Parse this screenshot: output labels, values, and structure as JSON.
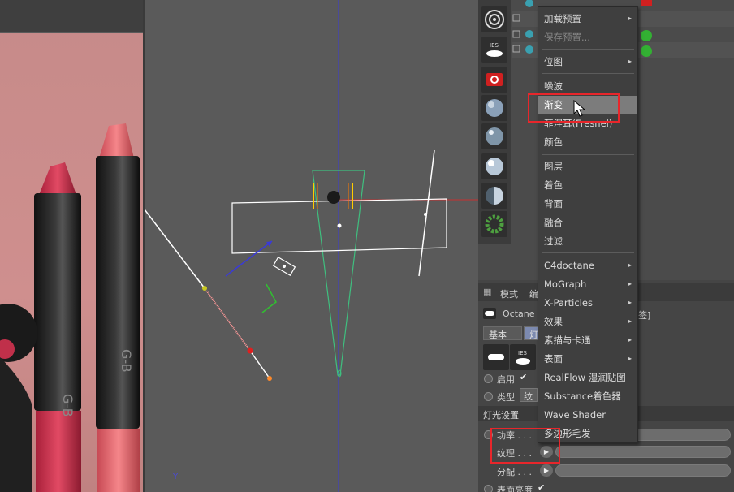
{
  "menu": {
    "items": [
      {
        "label": "加载预置",
        "has_sub": true,
        "disabled": false
      },
      {
        "label": "保存预置...",
        "has_sub": false,
        "disabled": true
      },
      {
        "label": "位图",
        "has_sub": true,
        "disabled": false
      },
      {
        "label": "噪波",
        "has_sub": false,
        "disabled": false
      },
      {
        "label": "渐变",
        "has_sub": false,
        "disabled": false,
        "highlighted": true
      },
      {
        "label": "菲涅耳(Fresnel)",
        "has_sub": false,
        "disabled": false
      },
      {
        "label": "颜色",
        "has_sub": false,
        "disabled": false
      },
      {
        "label": "图层",
        "has_sub": false,
        "disabled": false
      },
      {
        "label": "着色",
        "has_sub": false,
        "disabled": false
      },
      {
        "label": "背面",
        "has_sub": false,
        "disabled": false
      },
      {
        "label": "融合",
        "has_sub": false,
        "disabled": false
      },
      {
        "label": "过滤",
        "has_sub": false,
        "disabled": false
      },
      {
        "label": "C4doctane",
        "has_sub": true,
        "disabled": false
      },
      {
        "label": "MoGraph",
        "has_sub": true,
        "disabled": false
      },
      {
        "label": "X-Particles",
        "has_sub": true,
        "disabled": false
      },
      {
        "label": "效果",
        "has_sub": true,
        "disabled": false
      },
      {
        "label": "素描与卡通",
        "has_sub": true,
        "disabled": false
      },
      {
        "label": "表面",
        "has_sub": true,
        "disabled": false
      },
      {
        "label": "RealFlow 湿润贴图",
        "has_sub": false,
        "disabled": false
      },
      {
        "label": "Substance着色器",
        "has_sub": false,
        "disabled": false
      },
      {
        "label": "Wave Shader",
        "has_sub": false,
        "disabled": false
      },
      {
        "label": "多边形毛发",
        "has_sub": false,
        "disabled": false
      }
    ],
    "submenu_arrow": "▸"
  },
  "attributes": {
    "header_mode": "模式",
    "header_edit_partial": "编",
    "object_name_partial": "Octane",
    "object_suffix_partial": "签]",
    "tab_basic": "基本",
    "tab_light_partial": "灯",
    "enable_label": "启用",
    "enable_check": "✔",
    "type_label": "类型",
    "type_value_partial": "纹",
    "section_title": "灯光设置",
    "power_label": "功率 . . .",
    "texture_label": "纹理 . . .",
    "distribution_label": "分配 . . .",
    "surface_brightness_label": "表面亮度",
    "surface_brightness_check": "✔"
  },
  "tools": {
    "ies_label": "IES"
  },
  "viewport": {
    "axis_label": "Y",
    "colors": {
      "selection_outline": "#ffffff",
      "light_cone": "#3fbf7f",
      "axis_blue": "#3a3ad8",
      "axis_red": "#c83030",
      "target_line": "#ff9999"
    }
  },
  "colors": {
    "highlight_box": "#e8262b",
    "menu_bg": "#3f3f3f",
    "menu_highlight": "#7c7c7c"
  }
}
